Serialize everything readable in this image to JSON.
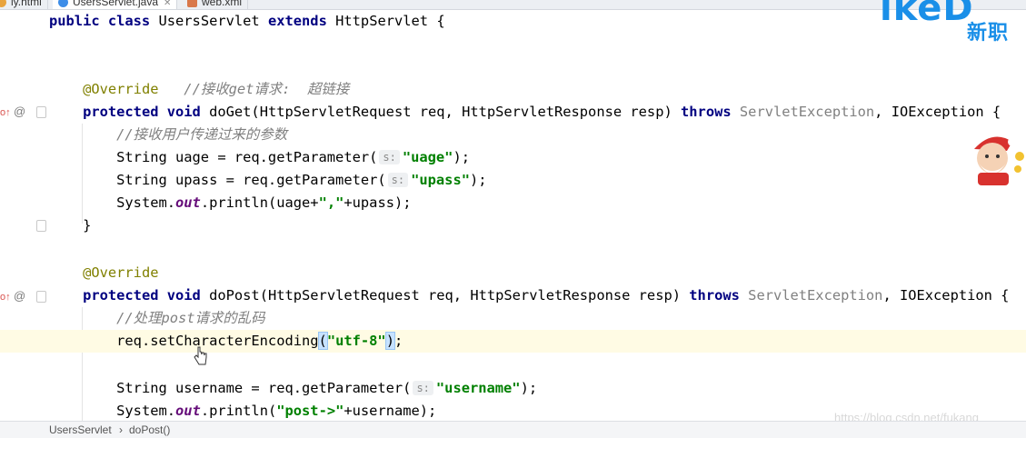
{
  "tabs": [
    {
      "label": "ly.html",
      "icon": "html-file-icon",
      "active": false
    },
    {
      "label": "UsersServlet.java",
      "icon": "java-class-icon",
      "active": true
    },
    {
      "label": "web.xml",
      "icon": "xml-file-icon",
      "active": false
    }
  ],
  "code": {
    "l1": {
      "kw1": "public class",
      "name": "UsersServlet",
      "kw2": "extends",
      "parent": "HttpServlet {"
    },
    "l4": {
      "ann": "@Override",
      "comment": "//接收get请求:  超链接"
    },
    "l5": {
      "kw1": "protected void",
      "sig": "doGet(HttpServletRequest req, HttpServletResponse resp)",
      "kw2": "throws",
      "ex1": "ServletException",
      "rest": ", IOException {"
    },
    "l6": {
      "comment": "//接收用户传递过来的参数"
    },
    "l7": {
      "pre": "String uage = req.getParameter(",
      "hint": "s:",
      "str": "\"uage\"",
      "post": ");"
    },
    "l8": {
      "pre": "String upass = req.getParameter(",
      "hint": "s:",
      "str": "\"upass\"",
      "post": ");"
    },
    "l9": {
      "pre": "System.",
      "fld": "out",
      "mid": ".println(uage+",
      "str": "\",\"",
      "post": "+upass);"
    },
    "l10": {
      "text": "}"
    },
    "l12": {
      "ann": "@Override"
    },
    "l13": {
      "kw1": "protected void",
      "sig": "doPost(HttpServletRequest req, HttpServletResponse resp)",
      "kw2": "throws",
      "ex1": "ServletException",
      "rest": ", IOException {"
    },
    "l14": {
      "comment": "//处理post请求的乱码"
    },
    "l15": {
      "pre": "req.setCharacterEncoding",
      "open": "(",
      "str": "\"utf-8\"",
      "close": ")",
      "post": ";"
    },
    "l17": {
      "pre": "String username = req.getParameter(",
      "hint": "s:",
      "str": "\"username\"",
      "post": ");"
    },
    "l18": {
      "pre": "System.",
      "fld": "out",
      "mid": ".println(",
      "str": "\"post->\"",
      "post": "+username);"
    }
  },
  "breadcrumb": {
    "class": "UsersServlet",
    "sep": "›",
    "method": "doPost()"
  },
  "logo": {
    "top": "ikeD",
    "sub": "新职"
  },
  "watermark": "https://blog.csdn.net/fukang_",
  "colors": {
    "keyword": "#000080",
    "string": "#008000",
    "annotation": "#808000",
    "comment": "#808080",
    "current_line": "#fffbe4",
    "logo": "#1a8fe8"
  }
}
